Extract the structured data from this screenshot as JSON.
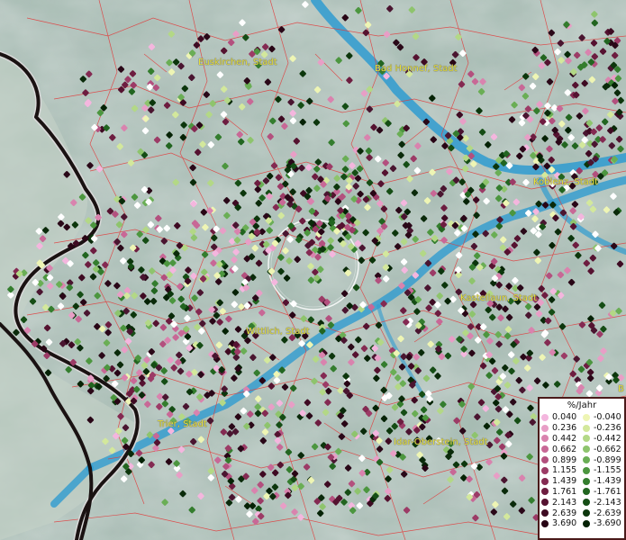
{
  "cities": [
    {
      "id": "euskirchen",
      "label": "Euskirchen, Stadt"
    },
    {
      "id": "bad-honnef",
      "label": "Bad Honnef, Stadt"
    },
    {
      "id": "koblenz",
      "label": "Koblenz, Stadt"
    },
    {
      "id": "kastellaun",
      "label": "Kastellaun, Stadt"
    },
    {
      "id": "wittlich",
      "label": "Wittlich, Stadt"
    },
    {
      "id": "trier",
      "label": "Trier, Stadt"
    },
    {
      "id": "idar-oberstein",
      "label": "Idar-Oberstein, Stadt"
    },
    {
      "id": "edge-label",
      "label": "B"
    }
  ],
  "legend": {
    "title": "%/Jahr",
    "positive": [
      {
        "value": "0.040",
        "color": "#f4b6de"
      },
      {
        "value": "0.236",
        "color": "#e89ec6"
      },
      {
        "value": "0.442",
        "color": "#d983ae"
      },
      {
        "value": "0.662",
        "color": "#c86896"
      },
      {
        "value": "0.899",
        "color": "#b3507e"
      },
      {
        "value": "1.155",
        "color": "#9c3b66"
      },
      {
        "value": "1.439",
        "color": "#842a52"
      },
      {
        "value": "1.761",
        "color": "#6d1d40"
      },
      {
        "value": "2.143",
        "color": "#551230"
      },
      {
        "value": "2.639",
        "color": "#3e0a22"
      },
      {
        "value": "3.690",
        "color": "#280515"
      }
    ],
    "negative": [
      {
        "value": "-0.040",
        "color": "#eef5b4"
      },
      {
        "value": "-0.236",
        "color": "#d3e89c"
      },
      {
        "value": "-0.442",
        "color": "#b3d886"
      },
      {
        "value": "-0.662",
        "color": "#8ec46d"
      },
      {
        "value": "-0.899",
        "color": "#6aae55"
      },
      {
        "value": "-1.155",
        "color": "#4c963f"
      },
      {
        "value": "-1.439",
        "color": "#347d2e"
      },
      {
        "value": "-1.761",
        "color": "#226520"
      },
      {
        "value": "-2.143",
        "color": "#154d15"
      },
      {
        "value": "-2.639",
        "color": "#0c360c"
      },
      {
        "value": "-3.690",
        "color": "#052205"
      }
    ]
  },
  "colors": {
    "river": "#2f9bd0",
    "border": "#1a1212",
    "district-lines": "#e23a3a",
    "label": "#e8e23a",
    "terrain": "#9fb5ad"
  }
}
